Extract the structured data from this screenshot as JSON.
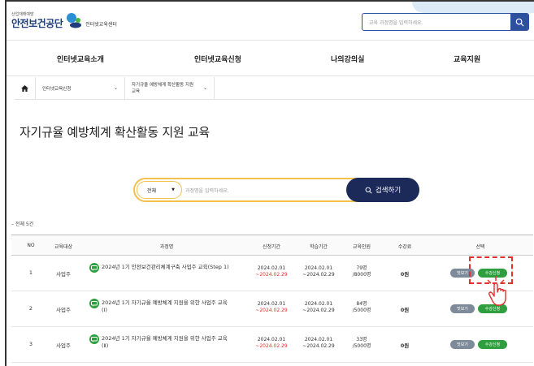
{
  "colors": {
    "brand": "#1f3d7a",
    "accent": "#f2c14e",
    "dark_button": "#1c2a5a",
    "apply_green": "#2e9e3e",
    "view_gray": "#7d8a99",
    "deadline_red": "#e0312d"
  },
  "header": {
    "logo_small": "산업재해예방",
    "logo_main": "안전보건공단",
    "logo_sub": "인터넷교육센터",
    "search_placeholder": "교육 과정명을 입력하세요.",
    "search_icon": "search-icon"
  },
  "nav": {
    "items": [
      "인터넷교육소개",
      "인터넷교육신청",
      "나의강의실",
      "교육지원"
    ]
  },
  "breadcrumb": {
    "home_icon": "home-icon",
    "level1": "인터넷교육신청",
    "level2_line1": "자기규율 예방체계 확산활동 지원",
    "level2_line2": "교육"
  },
  "page": {
    "title": "자기규율 예방체계 확산활동 지원 교육"
  },
  "search": {
    "select_value": "전체",
    "placeholder": "과정명을 입력하세요.",
    "button_label": "검색하기"
  },
  "list": {
    "count_text": "전체 5건"
  },
  "table": {
    "headers": [
      "NO",
      "교육대상",
      "과정명",
      "신청기간",
      "학습기간",
      "교육인원",
      "수강료",
      "선택"
    ],
    "rows": [
      {
        "no": "1",
        "target": "사업주",
        "course_line1": "2024년 1기 안전보건관리체계구축 사업주 교육(Step 1)",
        "course_line2": "",
        "apply_start": "2024.02.01",
        "apply_end": "~2024.02.29",
        "study_start": "2024.02.01",
        "study_end": "~2024.02.29",
        "capacity_now": "79명",
        "capacity_max": "/8000명",
        "fee": "0원",
        "view_label": "맛보기",
        "apply_label": "수강신청"
      },
      {
        "no": "2",
        "target": "사업주",
        "course_line1": "2024년 1기 자기규율 예방체계 지원을 위한 사업주 교육",
        "course_line2": "(Ⅰ)",
        "apply_start": "2024.02.01",
        "apply_end": "~2024.02.29",
        "study_start": "2024.02.01",
        "study_end": "~2024.02.29",
        "capacity_now": "84명",
        "capacity_max": "/5000명",
        "fee": "0원",
        "view_label": "맛보기",
        "apply_label": "수강신청"
      },
      {
        "no": "3",
        "target": "사업주",
        "course_line1": "2024년 1기 자기규율 예방체계 지원을 위한 사업주 교육",
        "course_line2": "(Ⅱ)",
        "apply_start": "2024.02.01",
        "apply_end": "~2024.02.29",
        "study_start": "2024.02.01",
        "study_end": "~2024.02.29",
        "capacity_now": "33명",
        "capacity_max": "/5000명",
        "fee": "0원",
        "view_label": "맛보기",
        "apply_label": "수강신청"
      }
    ]
  }
}
